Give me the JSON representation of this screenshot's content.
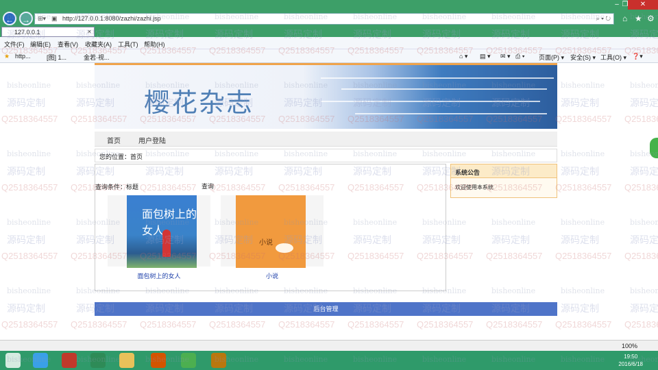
{
  "browser": {
    "url": "http://127.0.0.1:8080/zazhi/zazhi.jsp",
    "tab_title": "127.0.0.1",
    "menu": [
      "文件(F)",
      "编辑(E)",
      "查看(V)",
      "收藏夹(A)",
      "工具(T)",
      "帮助(H)"
    ],
    "fav_items": [
      "http...",
      "[图] 1...",
      "金若·视..."
    ],
    "tools": [
      "页面(P) ▾",
      "安全(S) ▾",
      "工具(O) ▾"
    ],
    "zoom": "100%"
  },
  "page": {
    "banner_title": "樱花杂志",
    "nav": [
      "首页",
      "用户登陆"
    ],
    "breadcrumb": "您的位置：首页",
    "query_label": "查询条件：标题",
    "query_button": "查询",
    "books": [
      {
        "title": "面包树上的女人",
        "label": "面包树上的女人"
      },
      {
        "title": "小说",
        "label": "小说"
      }
    ],
    "sidebar": {
      "title": "系统公告",
      "text": "欢迎使用本系统"
    },
    "footer": "后台管理"
  },
  "taskbar": {
    "time": "19:50",
    "date": "2016/6/18"
  },
  "watermark": {
    "en": "bisheonline",
    "cn": "源码定制",
    "num": "Q2518364557"
  }
}
